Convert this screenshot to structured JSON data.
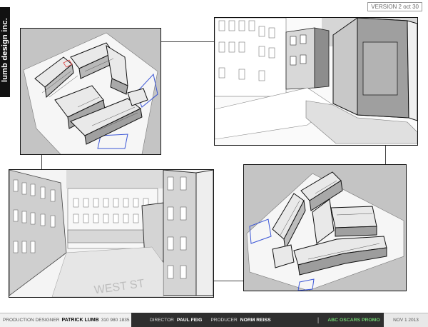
{
  "header": {
    "version": "VERSION 2 oct 30",
    "logo_text": "lumb design inc."
  },
  "panels": [
    {
      "id": "aerial-top-left"
    },
    {
      "id": "street-top-right"
    },
    {
      "id": "street-bottom-left",
      "street_marking": "WEST ST"
    },
    {
      "id": "aerial-bottom-right"
    }
  ],
  "footer": {
    "designer_role": "PRODUCTION DESIGNER",
    "designer_name": "PATRICK LUMB",
    "designer_phone": "310 980 1835",
    "director_role": "DIRECTOR",
    "director_name": "PAUL FEIG",
    "producer_role": "PRODUCER",
    "producer_name": "NORM REISS",
    "divider": "|",
    "project": "ABC OSCARS PROMO",
    "date": "NOV 1 2013"
  },
  "colors": {
    "ground_gray": "#b3b3b3",
    "blue_outline": "#3b56d6",
    "footer_dark": "#2f2f2f",
    "promo_green": "#6fd16f"
  }
}
